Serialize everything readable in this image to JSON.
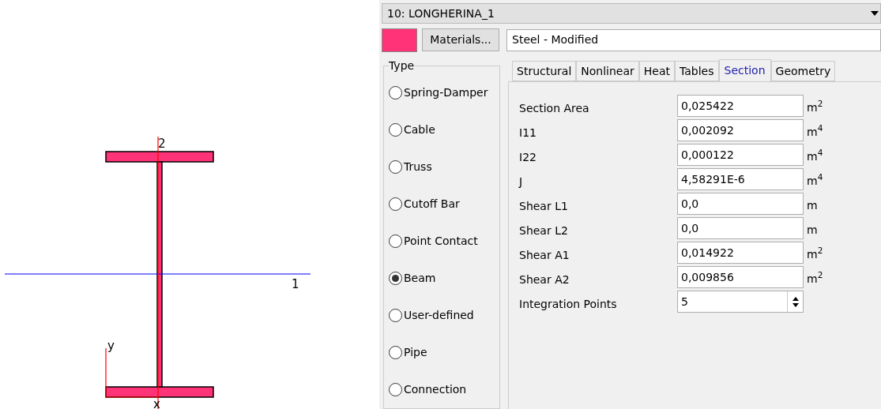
{
  "diagram": {
    "axis_labels": [
      "2",
      "1",
      "y",
      "x"
    ]
  },
  "element": {
    "title": "10: LONGHERINA_1",
    "color": "#ff3377",
    "materials_button": "Materials...",
    "material": "Steel - Modified"
  },
  "type_group": {
    "title": "Type",
    "options": [
      {
        "label": "Spring-Damper",
        "selected": false
      },
      {
        "label": "Cable",
        "selected": false
      },
      {
        "label": "Truss",
        "selected": false
      },
      {
        "label": "Cutoff Bar",
        "selected": false
      },
      {
        "label": "Point Contact",
        "selected": false
      },
      {
        "label": "Beam",
        "selected": true
      },
      {
        "label": "User-defined",
        "selected": false
      },
      {
        "label": "Pipe",
        "selected": false
      },
      {
        "label": "Connection",
        "selected": false
      }
    ]
  },
  "tabs": [
    {
      "label": "Structural",
      "selected": false
    },
    {
      "label": "Nonlinear",
      "selected": false
    },
    {
      "label": "Heat",
      "selected": false
    },
    {
      "label": "Tables",
      "selected": false
    },
    {
      "label": "Section",
      "selected": true
    },
    {
      "label": "Geometry",
      "selected": false
    }
  ],
  "section": [
    {
      "kind": "field",
      "label": "Section Area",
      "value": "0,025422",
      "unit": "m$^{2}$"
    },
    {
      "kind": "field",
      "label": "I11",
      "value": "0,002092",
      "unit": "m$^{4}$"
    },
    {
      "kind": "field",
      "label": "I22",
      "value": "0,000122",
      "unit": "m$^{4}$"
    },
    {
      "kind": "field",
      "label": "J",
      "value": "4,58291E-6",
      "unit": "m$^{4}$"
    },
    {
      "kind": "field",
      "label": "Shear L1",
      "value": "0,0",
      "unit": "m"
    },
    {
      "kind": "field",
      "label": "Shear L2",
      "value": "0,0",
      "unit": "m"
    },
    {
      "kind": "field",
      "label": "Shear A1",
      "value": "0,014922",
      "unit": "m$^{2}$"
    },
    {
      "kind": "field",
      "label": "Shear A2",
      "value": "0,009856",
      "unit": "m$^{2}$"
    },
    {
      "kind": "spinner",
      "label": "Integration Points",
      "value": "5"
    }
  ]
}
